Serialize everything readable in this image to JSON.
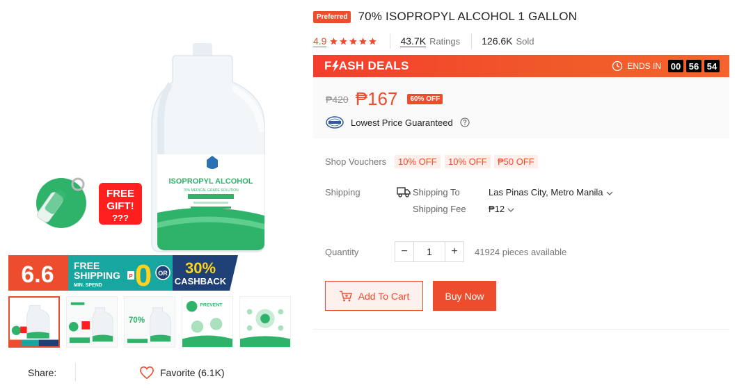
{
  "product": {
    "preferred_badge": "Preferred",
    "title": "70% ISOPROPYL ALCOHOL 1 GALLON",
    "rating": "4.9",
    "stars": 5,
    "ratings_count": "43.7K",
    "ratings_label": "Ratings",
    "sold_count": "126.6K",
    "sold_label": "Sold"
  },
  "flash": {
    "title_part1": "F",
    "title_part2": "ASH DEALS",
    "ends_label": "ENDS IN",
    "hours": "00",
    "minutes": "56",
    "seconds": "54"
  },
  "price": {
    "old": "₱420",
    "new": "₱167",
    "off": "60% OFF",
    "guarantee_text": "Lowest Price Guaranteed"
  },
  "vouchers": {
    "label": "Shop Vouchers",
    "items": [
      "10% OFF",
      "10% OFF",
      "₱50 OFF"
    ]
  },
  "shipping": {
    "label": "Shipping",
    "to_label": "Shipping To",
    "to_value": "Las Pinas City, Metro Manila",
    "fee_label": "Shipping Fee",
    "fee_value": "₱12"
  },
  "quantity": {
    "label": "Quantity",
    "minus": "−",
    "value": "1",
    "plus": "+",
    "available": "41924 pieces available"
  },
  "actions": {
    "add_to_cart": "Add To Cart",
    "buy_now": "Buy Now"
  },
  "share": {
    "label": "Share:",
    "favorite": "Favorite (6.1K)"
  },
  "image": {
    "bottle_label": "ISOPROPYL ALCOHOL",
    "bottle_sub": "70% MEDICAL GRADE SOLUTION",
    "gift_text_1": "FREE",
    "gift_text_2": "GIFT!",
    "gift_text_3": "???",
    "banner_66": "6.6",
    "banner_free": "FREE",
    "banner_shipping": "SHIPPING",
    "banner_min": "MIN. SPEND",
    "banner_p": "P",
    "banner_zero": "0",
    "banner_or": "OR",
    "banner_pct": "30%",
    "banner_cashback": "CASHBACK",
    "thumb3_text": "70%",
    "thumb4_text": "PREVENT"
  },
  "colors": {
    "brand": "#ee4d2d",
    "green": "#2fb36b",
    "navy": "#1f3f77",
    "yellow": "#ffd21f"
  }
}
